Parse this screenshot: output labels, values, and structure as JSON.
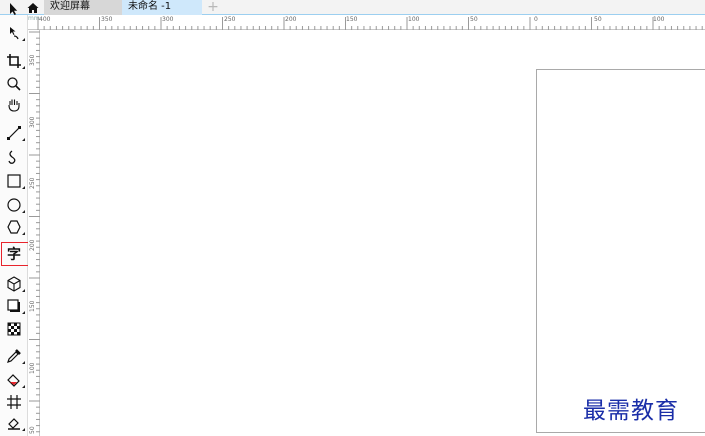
{
  "tabs": [
    {
      "label": "欢迎屏幕"
    },
    {
      "label": "未命名 -1"
    }
  ],
  "ruler": {
    "top_labels": [
      "400",
      "350",
      "300",
      "250",
      "200",
      "150",
      "100",
      "50",
      "0",
      "50",
      "100"
    ],
    "left_labels": [
      "350",
      "300",
      "250",
      "200",
      "150",
      "100",
      "50"
    ],
    "corner": "mm"
  },
  "toolbox": {
    "items": [
      {
        "name": "pick-tool",
        "icon": "arrow-pointer"
      },
      {
        "name": "shape-tool",
        "icon": "node-edit"
      },
      {
        "name": "crop-tool",
        "icon": "crop"
      },
      {
        "name": "zoom-tool",
        "icon": "magnifier"
      },
      {
        "name": "pan-tool",
        "icon": "hand"
      },
      {
        "name": "freehand-tool",
        "icon": "line"
      },
      {
        "name": "artistic-media-tool",
        "icon": "curve"
      },
      {
        "name": "rectangle-tool",
        "icon": "rectangle"
      },
      {
        "name": "ellipse-tool",
        "icon": "ellipse"
      },
      {
        "name": "polygon-tool",
        "icon": "polygon"
      },
      {
        "name": "text-tool",
        "icon": "字",
        "selected": true
      },
      {
        "name": "parallel-dimension-tool",
        "icon": "cube"
      },
      {
        "name": "drop-shadow-tool",
        "icon": "shadow"
      },
      {
        "name": "transparency-tool",
        "icon": "checker"
      },
      {
        "name": "color-eyedropper-tool",
        "icon": "eyedropper"
      },
      {
        "name": "interactive-fill-tool",
        "icon": "paint-bucket"
      },
      {
        "name": "mesh-fill-tool",
        "icon": "mesh"
      },
      {
        "name": "smart-fill-tool",
        "icon": "smart-fill"
      }
    ]
  },
  "watermark": "最需教育",
  "colors": {
    "selected_outline": "#e8242c",
    "active_tab": "#cfe8fb",
    "watermark": "#1a2ea8"
  }
}
